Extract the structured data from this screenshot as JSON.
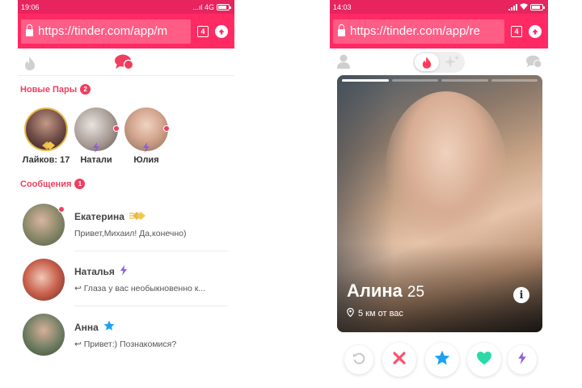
{
  "colors": {
    "brand": "#ff2a63",
    "accent": "#ef3e5f",
    "super_like": "#1da1f2",
    "boost": "#915dd9",
    "like": "#2bd9a8"
  },
  "left": {
    "status": {
      "time": "19:06",
      "network": "...ıl 4G"
    },
    "browser": {
      "url": "https://tinder.com/app/m",
      "tab_count": "4"
    },
    "nav": {
      "icons": [
        "flame-icon",
        "chat-bubbles-icon"
      ]
    },
    "new_matches": {
      "title": "Новые Пары",
      "count": "2",
      "items": [
        {
          "label": "Лайков: 17",
          "icon": "gold-likes-icon"
        },
        {
          "label": "Натали",
          "icon": "boost-bolt-icon",
          "online": true
        },
        {
          "label": "Юлия",
          "icon": "boost-bolt-icon",
          "online": true
        }
      ]
    },
    "messages": {
      "title": "Сообщения",
      "count": "1",
      "items": [
        {
          "name": "Екатерина",
          "preview": "Привет,Михаил! Да,конечно)",
          "icon": "gold-likes-icon",
          "online": true
        },
        {
          "name": "Наталья",
          "preview": "↩ Глаза у вас необыкновенно к...",
          "icon": "boost-bolt-icon"
        },
        {
          "name": "Анна",
          "preview": "↩ Привет:) Познакомися?",
          "icon": "super-like-star-icon"
        }
      ]
    }
  },
  "right": {
    "status": {
      "time": "14:03"
    },
    "browser": {
      "url": "https://tinder.com/app/re",
      "tab_count": "4"
    },
    "nav": {
      "icons": [
        "profile-icon",
        "flame-icon",
        "sparkle-icon",
        "chat-bubbles-icon"
      ]
    },
    "card": {
      "name": "Алина",
      "age": "25",
      "distance": "5 км от вас",
      "photos_total": 4,
      "photo_active": 1
    },
    "actions": [
      "rewind-icon",
      "nope-x-icon",
      "super-like-star-icon",
      "like-heart-icon",
      "boost-bolt-icon"
    ]
  }
}
